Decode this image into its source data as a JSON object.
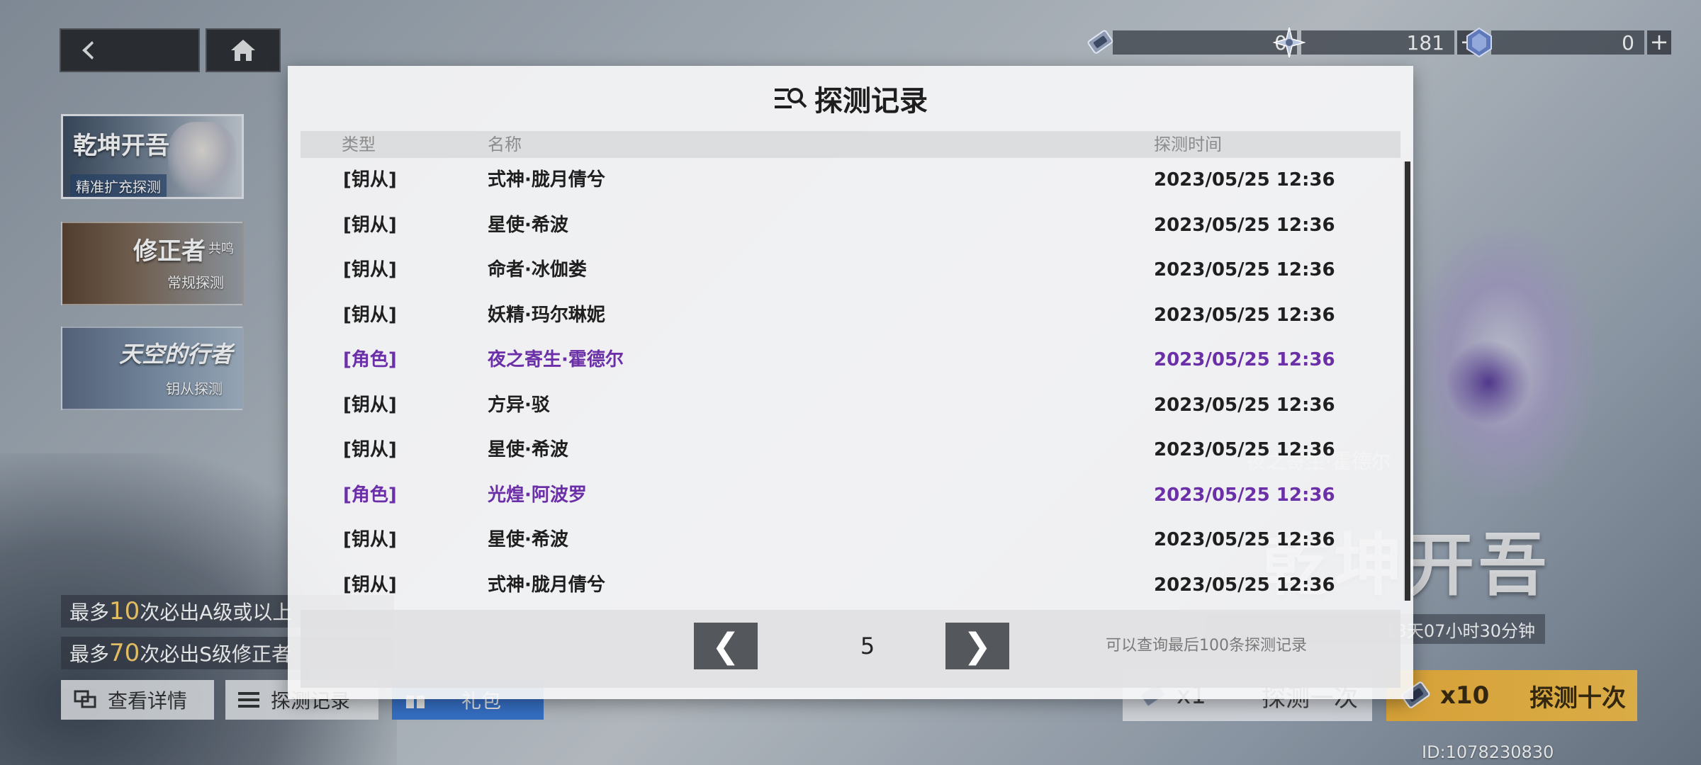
{
  "nav": {
    "back_icon": "back-arrow-icon",
    "home_icon": "home-icon"
  },
  "currency": [
    {
      "icon": "ticket-icon",
      "value": "0",
      "plus": ""
    },
    {
      "icon": "star-crystal-icon",
      "value": "181",
      "plus": "+"
    },
    {
      "icon": "blue-crystal-icon",
      "value": "0",
      "plus": "+"
    }
  ],
  "banners": [
    {
      "title": "乾坤开吾",
      "sub": "精准扩充探测"
    },
    {
      "title": "修正者",
      "title_small": "共鸣",
      "sub": "常规探测"
    },
    {
      "title": "天空的行者",
      "sub": "钥从探测"
    }
  ],
  "pity": [
    {
      "pre": "最多",
      "num": "10",
      "post": "次必出A级或以上"
    },
    {
      "pre": "最多",
      "num": "70",
      "post": "次必出S级修正者"
    }
  ],
  "bottom_buttons": {
    "detail": "查看详情",
    "record": "探测记录",
    "gift": "礼包"
  },
  "modal": {
    "title": "探测记录",
    "columns": {
      "type": "类型",
      "name": "名称",
      "time": "探测时间"
    },
    "rows": [
      {
        "type": "[钥从]",
        "name": "式神·胧月倩兮",
        "time": "2023/05/25 12:36",
        "role": false
      },
      {
        "type": "[钥从]",
        "name": "星使·希波",
        "time": "2023/05/25 12:36",
        "role": false
      },
      {
        "type": "[钥从]",
        "name": "命者·冰伽娄",
        "time": "2023/05/25 12:36",
        "role": false
      },
      {
        "type": "[钥从]",
        "name": "妖精·玛尔琳妮",
        "time": "2023/05/25 12:36",
        "role": false
      },
      {
        "type": "[角色]",
        "name": "夜之寄生·霍德尔",
        "time": "2023/05/25 12:36",
        "role": true
      },
      {
        "type": "[钥从]",
        "name": "方异·驳",
        "time": "2023/05/25 12:36",
        "role": false
      },
      {
        "type": "[钥从]",
        "name": "星使·希波",
        "time": "2023/05/25 12:36",
        "role": false
      },
      {
        "type": "[角色]",
        "name": "光煌·阿波罗",
        "time": "2023/05/25 12:36",
        "role": true
      },
      {
        "type": "[钥从]",
        "name": "星使·希波",
        "time": "2023/05/25 12:36",
        "role": false
      },
      {
        "type": "[钥从]",
        "name": "式神·胧月倩兮",
        "time": "2023/05/25 12:36",
        "role": false
      }
    ],
    "pager": {
      "prev": "❮",
      "next": "❯",
      "page": "5",
      "note": "可以查询最后100条探测记录"
    }
  },
  "right": {
    "timer": "13天07小时30分钟",
    "feature_name": "夜之寄生·霍德尔",
    "feature_calli": "乾坤开吾",
    "draw_one": {
      "count": "x1",
      "label": "探测一次"
    },
    "draw_ten": {
      "count": "x10",
      "label": "探测十次"
    },
    "player_id": "ID:1078230830"
  },
  "colors": {
    "role_purple": "#6b2fa8",
    "highlight_yellow": "#ffd36a",
    "gift_blue": "#3b7ad9",
    "draw_gold": "#f2b43c"
  }
}
